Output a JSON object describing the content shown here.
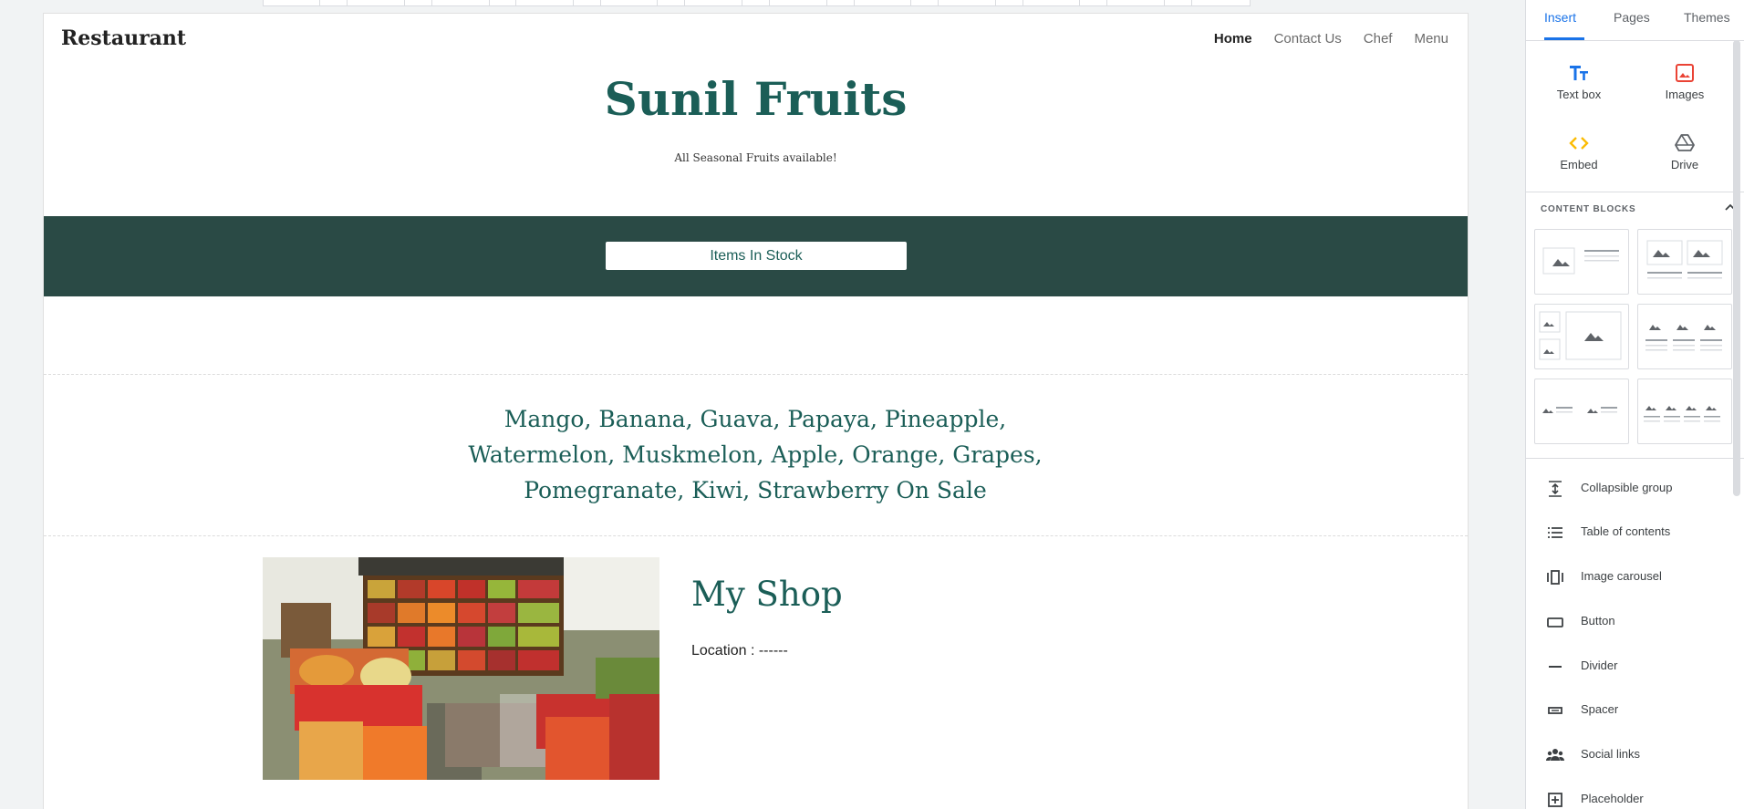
{
  "site": {
    "title": "Restaurant",
    "nav": [
      "Home",
      "Contact Us",
      "Chef",
      "Menu"
    ],
    "hero_title": "Sunil Fruits",
    "hero_subtitle": "All Seasonal Fruits available!",
    "stock_button": "Items In Stock",
    "sale_text": "Mango, Banana, Guava, Papaya, Pineapple, Watermelon, Muskmelon, Apple, Orange, Grapes, Pomegranate, Kiwi, Strawberry On Sale",
    "shop_heading": "My Shop",
    "shop_location": "Location : ------"
  },
  "panel": {
    "tabs": [
      "Insert",
      "Pages",
      "Themes"
    ],
    "insert_items": [
      {
        "label": "Text box",
        "icon": "text-box-icon"
      },
      {
        "label": "Images",
        "icon": "images-icon"
      },
      {
        "label": "Embed",
        "icon": "embed-icon"
      },
      {
        "label": "Drive",
        "icon": "drive-icon"
      }
    ],
    "content_blocks_heading": "CONTENT BLOCKS",
    "list_items": [
      {
        "label": "Collapsible group",
        "icon": "collapsible-group-icon"
      },
      {
        "label": "Table of contents",
        "icon": "table-of-contents-icon"
      },
      {
        "label": "Image carousel",
        "icon": "image-carousel-icon"
      },
      {
        "label": "Button",
        "icon": "button-icon"
      },
      {
        "label": "Divider",
        "icon": "divider-icon"
      },
      {
        "label": "Spacer",
        "icon": "spacer-icon"
      },
      {
        "label": "Social links",
        "icon": "social-links-icon"
      },
      {
        "label": "Placeholder",
        "icon": "placeholder-icon"
      }
    ]
  },
  "colors": {
    "accent_green": "#1b5e57",
    "band_green": "#2a4a45",
    "google_blue": "#1a73e8"
  }
}
